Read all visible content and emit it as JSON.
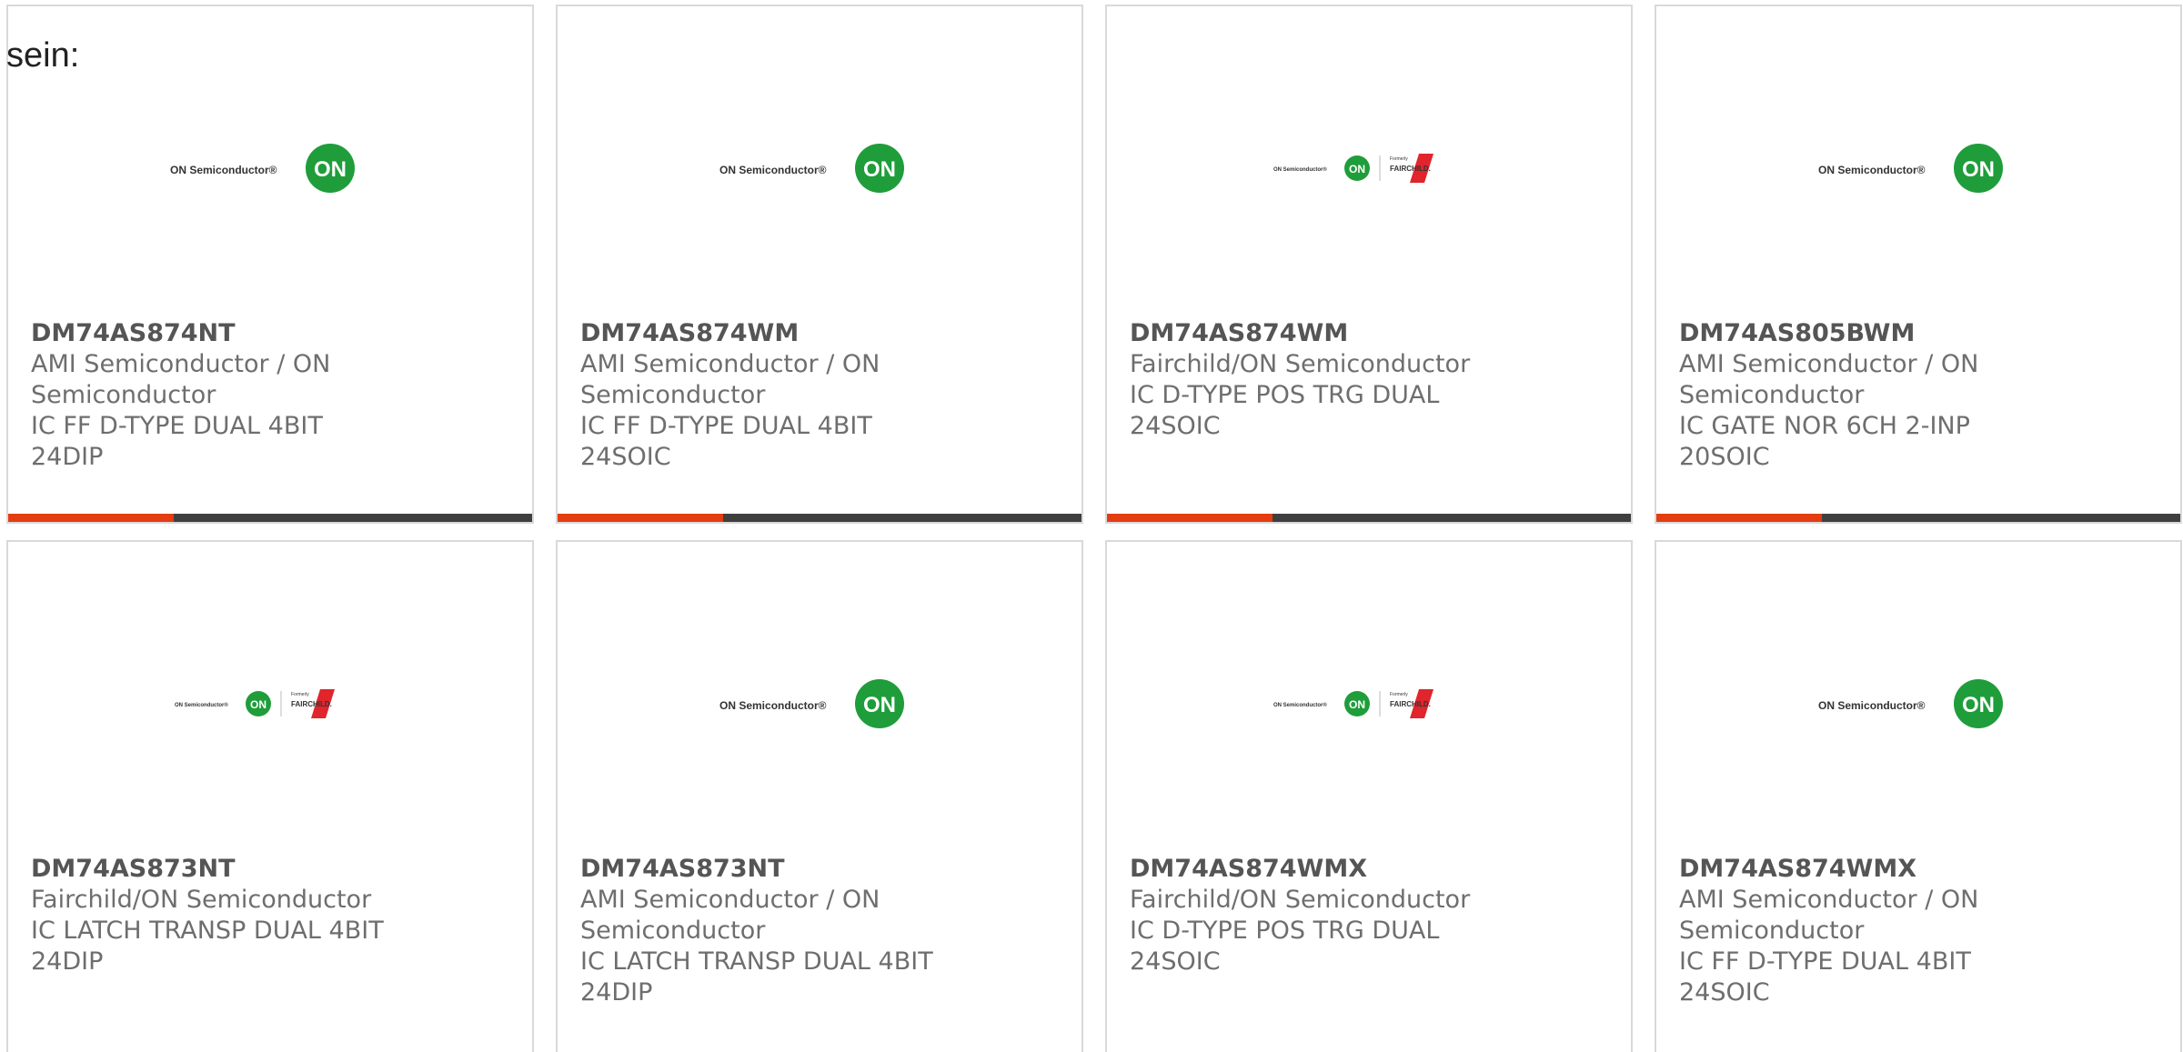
{
  "intro_text": "sein:",
  "colors": {
    "accent": "#e33d12",
    "bar_dark": "#3f3f3f",
    "on_green": "#1f9d3a",
    "fairchild_red": "#e0252c"
  },
  "logos": {
    "on": "ON Semiconductor",
    "on_badge": "ON",
    "fairchild_formerly": "Formerly",
    "fairchild": "FAIRCHILD."
  },
  "cards": [
    {
      "part": "DM74AS874NT",
      "manufacturer": "AMI Semiconductor / ON Semiconductor",
      "description": "IC FF D-TYPE DUAL 4BIT 24DIP",
      "logo": "on"
    },
    {
      "part": "DM74AS874WM",
      "manufacturer": "AMI Semiconductor / ON Semiconductor",
      "description": "IC FF D-TYPE DUAL 4BIT 24SOIC",
      "logo": "on"
    },
    {
      "part": "DM74AS874WM",
      "manufacturer": "Fairchild/ON Semiconductor",
      "description": "IC D-TYPE POS TRG DUAL 24SOIC",
      "logo": "on-fairchild"
    },
    {
      "part": "DM74AS805BWM",
      "manufacturer": "AMI Semiconductor / ON Semiconductor",
      "description": "IC GATE NOR 6CH 2-INP 20SOIC",
      "logo": "on"
    },
    {
      "part": "DM74AS873NT",
      "manufacturer": "Fairchild/ON Semiconductor",
      "description": "IC LATCH TRANSP DUAL 4BIT 24DIP",
      "logo": "on-fairchild"
    },
    {
      "part": "DM74AS873NT",
      "manufacturer": "AMI Semiconductor / ON Semiconductor",
      "description": "IC LATCH TRANSP DUAL 4BIT 24DIP",
      "logo": "on"
    },
    {
      "part": "DM74AS874WMX",
      "manufacturer": "Fairchild/ON Semiconductor",
      "description": "IC D-TYPE POS TRG DUAL 24SOIC",
      "logo": "on-fairchild"
    },
    {
      "part": "DM74AS874WMX",
      "manufacturer": "AMI Semiconductor / ON Semiconductor",
      "description": "IC FF D-TYPE DUAL 4BIT 24SOIC",
      "logo": "on"
    }
  ]
}
